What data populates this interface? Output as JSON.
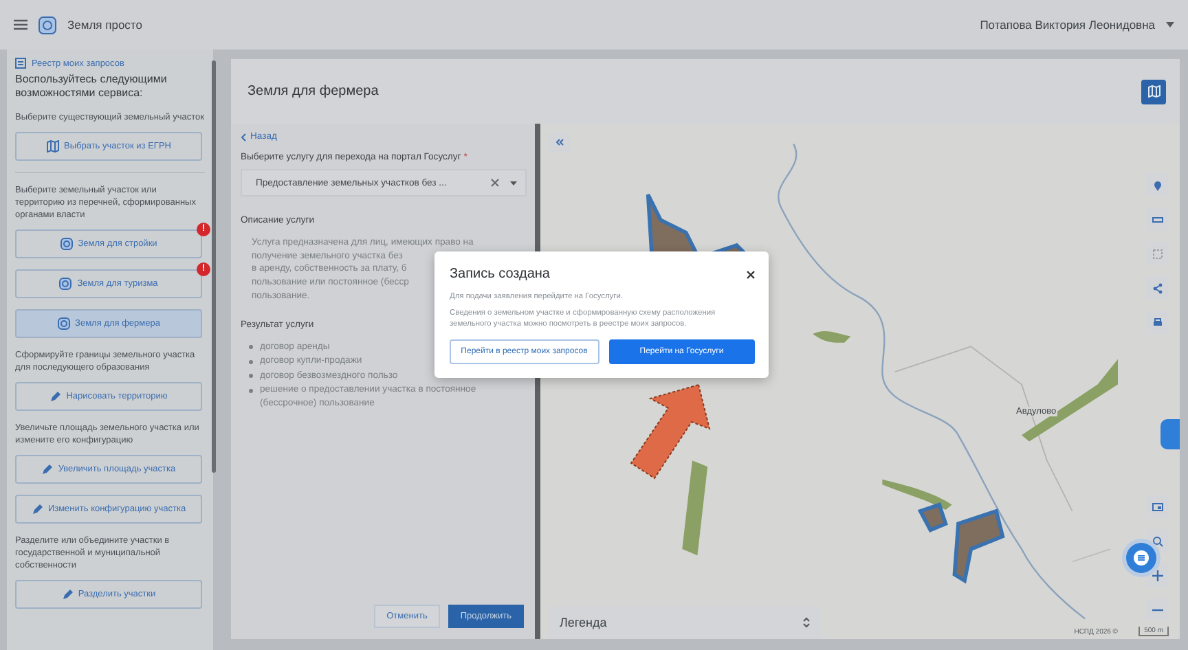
{
  "topbar": {
    "app_title": "Земля просто",
    "user_name": "Потапова Виктория Леонидовна"
  },
  "sidebar": {
    "registry_link": "Реестр моих запросов",
    "heading": "Воспользуйтесь следующими возможностями сервиса:",
    "items": [
      {
        "kind": "text",
        "text": "Выберите существующий земельный участок"
      },
      {
        "kind": "button",
        "label": "Выбрать участок из ЕГРН",
        "selected": false
      },
      {
        "kind": "divider"
      },
      {
        "kind": "text",
        "text": "Выберите земельный участок или территорию из перечней, сформированных органами власти"
      },
      {
        "kind": "button",
        "label": "Земля для стройки",
        "badge": "!",
        "selected": false
      },
      {
        "kind": "button",
        "label": "Земля для туризма",
        "badge": "!",
        "selected": false
      },
      {
        "kind": "button",
        "label": "Земля для фермера",
        "selected": true
      },
      {
        "kind": "text",
        "text": "Сформируйте границы земельного участка для последующего образования"
      },
      {
        "kind": "button",
        "label": "Нарисовать территорию",
        "selected": false
      },
      {
        "kind": "text",
        "text": "Увеличьте площадь земельного участка или измените его конфигурацию"
      },
      {
        "kind": "button",
        "label": "Увеличить площадь участка",
        "selected": false
      },
      {
        "kind": "button",
        "label": "Изменить конфигурацию участка",
        "selected": false
      },
      {
        "kind": "text",
        "text": "Разделите или объедините участки в государственной и муниципальной собственности"
      },
      {
        "kind": "button",
        "label": "Разделить участки",
        "selected": false
      }
    ]
  },
  "page": {
    "title": "Земля для фермера"
  },
  "form": {
    "back_link": "Назад",
    "service_label": "Выберите услугу для перехода на портал Госуслуг",
    "required_mark": "*",
    "service_value": "Предоставление земельных участков без ...",
    "description_heading": "Описание услуги",
    "description_lines": [
      "Услуга предназначена для лиц, имеющих право на",
      "получение земельного участка без",
      "в аренду, собственность за плату, б",
      "пользование или постоянное (бесср",
      "пользование."
    ],
    "result_heading": "Результат услуги",
    "results": [
      "договор аренды",
      "договор купли-продажи",
      "договор безвозмездного пользо",
      "решение о предоставлении участка в постоянное (бессрочное) пользование"
    ],
    "cancel_button": "Отменить",
    "continue_button": "Продолжить"
  },
  "map": {
    "place_label": "Авдулово",
    "legend": "Легенда",
    "attribution": "НСПД 2026 ©",
    "scale": "500 m"
  },
  "modal": {
    "title": "Запись создана",
    "text": "Для подачи заявления перейдите на Госуслуги.",
    "note": "Сведения о земельном участке и сформированную схему расположения земельного участка можно посмотреть в реестре моих запросов.",
    "secondary_button": "Перейти в реестр моих запросов",
    "primary_button": "Перейти на Госуслуги"
  }
}
